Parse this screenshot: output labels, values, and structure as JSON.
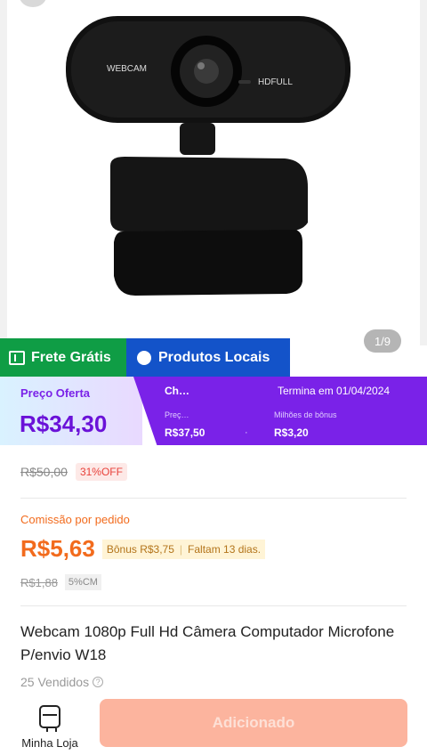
{
  "product": {
    "image_counter": "1/9",
    "camera_text_left": "WEBCAM",
    "camera_text_right": "HDFULL",
    "title": "Webcam 1080p Full Hd Câmera Computador Microfone P/envio W18",
    "sold": "25 Vendidos"
  },
  "tags": {
    "free_shipping": "Frete Grátis",
    "local_products": "Produtos Locais"
  },
  "offer": {
    "label": "Preço Oferta",
    "price": "R$34,30",
    "flash_label": "Ch…",
    "ends": "Termina em 01/04/2024",
    "price_label": "Preç…",
    "price_value": "R$37,50",
    "bonus_label": "Milhões de bônus",
    "bonus_value": "R$3,20",
    "dot": "·"
  },
  "pricing": {
    "original": "R$50,00",
    "discount": "31%OFF"
  },
  "commission": {
    "label": "Comissão por pedido",
    "value": "R$5,63",
    "bonus": "Bônus R$3,75",
    "remaining": "Faltam 13 dias.",
    "old_value": "R$1,88",
    "rate": "5%CM"
  },
  "bottom": {
    "store_label": "Minha Loja",
    "add_button": "Adicionado"
  },
  "colors": {
    "green": "#0f9d45",
    "blue": "#1353c9",
    "purple": "#7a22e8",
    "orange": "#f26b1d",
    "button": "#fcb49e"
  }
}
